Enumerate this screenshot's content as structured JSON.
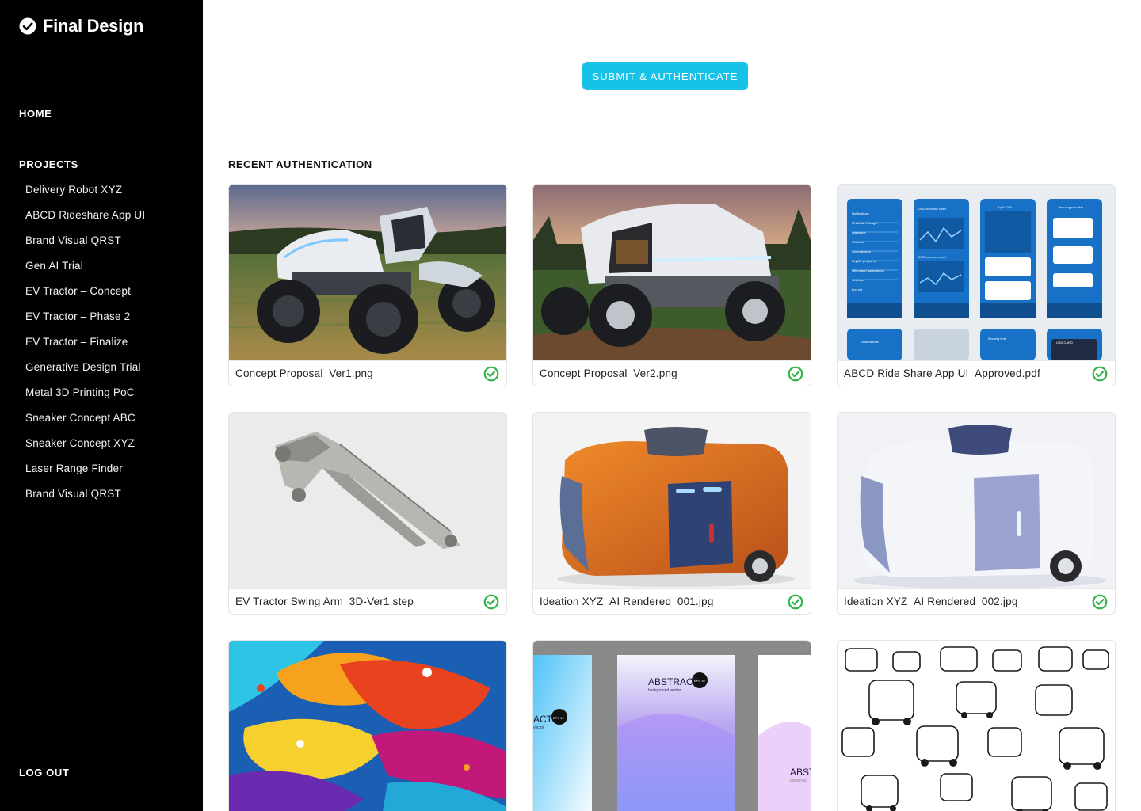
{
  "app": {
    "name": "Final Design",
    "logo_icon": "check-circle-icon"
  },
  "nav": {
    "home": "HOME",
    "projects_heading": "PROJECTS",
    "projects": [
      "Delivery Robot XYZ",
      "ABCD Rideshare App UI",
      "Brand Visual QRST",
      "Gen AI Trial",
      "EV Tractor – Concept",
      "EV Tractor – Phase 2",
      "EV Tractor – Finalize",
      "Generative Design Trial",
      "Metal 3D Printing PoC",
      "Sneaker Concept ABC",
      "Sneaker Concept XYZ",
      "Laser Range Finder",
      "Brand Visual QRST"
    ],
    "logout": "LOG OUT"
  },
  "actions": {
    "submit": "SUBMIT & AUTHENTICATE"
  },
  "recent": {
    "heading": "RECENT AUTHENTICATION",
    "items": [
      {
        "filename": "Concept Proposal_Ver1.png",
        "status": "authenticated",
        "status_icon": "check-circle-icon"
      },
      {
        "filename": "Concept Proposal_Ver2.png",
        "status": "authenticated",
        "status_icon": "check-circle-icon"
      },
      {
        "filename": "ABCD Ride Share App UI_Approved.pdf",
        "status": "authenticated",
        "status_icon": "check-circle-icon"
      },
      {
        "filename": "EV Tractor Swing Arm_3D-Ver1.step",
        "status": "authenticated",
        "status_icon": "check-circle-icon"
      },
      {
        "filename": "Ideation XYZ_AI Rendered_001.jpg",
        "status": "authenticated",
        "status_icon": "check-circle-icon"
      },
      {
        "filename": "Ideation XYZ_AI Rendered_002.jpg",
        "status": "authenticated",
        "status_icon": "check-circle-icon"
      },
      {
        "filename": "",
        "status": "",
        "status_icon": ""
      },
      {
        "filename": "",
        "status": "",
        "status_icon": ""
      },
      {
        "filename": "",
        "status": "",
        "status_icon": ""
      }
    ],
    "thumb_texts": {
      "poster_title": "ABSTRACT",
      "poster_sub": "background vector",
      "poster_badge": "EPS 10",
      "poster_left_title": "ACT",
      "poster_left_sub": "vector",
      "poster_right_title": "ABST",
      "poster_right_sub": "backgrou",
      "app_headers": [
        "USD currency chart",
        "EUR currency chart",
        "April 2023",
        "Tech support chat"
      ],
      "app_menu": [
        "Notifications",
        "Financial manager",
        "Insurance",
        "Interests",
        "Commissions",
        "Loyalty programs",
        "Offers and applications",
        "Settings",
        "Log out"
      ],
      "app_bottom": [
        "Notifications",
        "Security limit",
        "USD CARD"
      ]
    }
  },
  "colors": {
    "sidebar": "#000000",
    "accent": "#17c2e8",
    "success": "#2fb34a"
  }
}
